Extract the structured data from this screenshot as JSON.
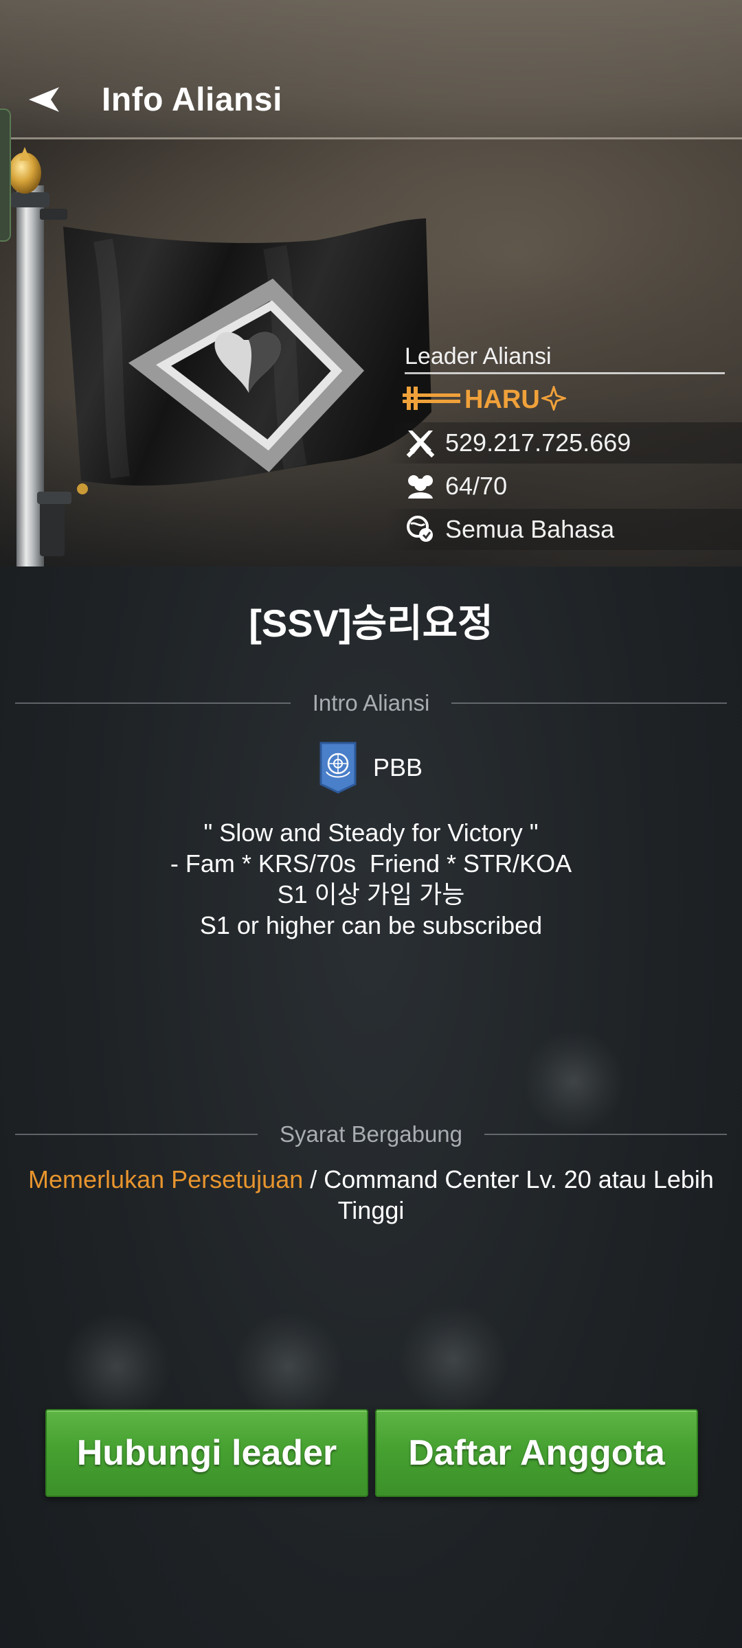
{
  "header": {
    "title": "Info Aliansi",
    "back_icon": "back-arrow-icon"
  },
  "leader": {
    "label": "Leader Aliansi",
    "name": "HARU",
    "name_color": "#f0a13a",
    "power": "529.217.725.669",
    "members": "64/70",
    "language": "Semua Bahasa"
  },
  "alliance": {
    "name": "[SSV]승리요정"
  },
  "intro": {
    "section_label": "Intro Aliansi",
    "language_flag_label": "PBB",
    "lines": [
      "\" Slow and Steady for Victory \"",
      "- Fam * KRS/70s  Friend * STR/KOA",
      "S1 이상 가입 가능",
      "S1 or higher can be subscribed"
    ]
  },
  "requirements": {
    "section_label": "Syarat Bergabung",
    "approval": "Memerlukan Persetujuan",
    "separator": " / ",
    "detail": "Command Center Lv. 20 atau Lebih Tinggi"
  },
  "buttons": {
    "contact_leader": "Hubungi leader",
    "member_list": "Daftar Anggota"
  },
  "colors": {
    "accent_orange": "#e8952e",
    "button_green": "#46a131",
    "background": "#1d2124"
  }
}
